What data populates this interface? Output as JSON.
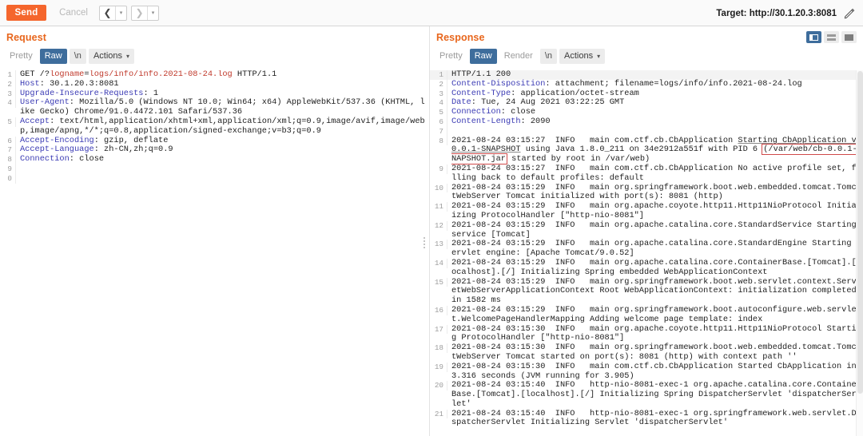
{
  "toolbar": {
    "send_label": "Send",
    "cancel_label": "Cancel",
    "prev_arrow": "❮",
    "next_arrow": "❯",
    "caret": "▾",
    "target_label": "Target: http://30.1.20.3:8081",
    "edit_icon": "pencil-icon"
  },
  "layout": {
    "split_vertical": "split-vertical-layout",
    "split_horizontal": "split-horizontal-layout",
    "single": "single-pane-layout",
    "selected": "split-vertical-layout"
  },
  "request": {
    "title": "Request",
    "tabs": [
      {
        "label": "Pretty",
        "active": false
      },
      {
        "label": "Raw",
        "active": true
      },
      {
        "label": "\\n",
        "active": false
      },
      {
        "label": "Actions",
        "active": false
      }
    ],
    "lines": [
      {
        "n": "1",
        "html": "<span class=\"first-line\">GET /?</span><span class=\"q-key\">logname</span><span class=\"first-line\">=</span><span class=\"q-val\">logs/info/info.2021-08-24.log</span><span class=\"first-line\"> HTTP/1.1</span>"
      },
      {
        "n": "2",
        "html": "<span class=\"hdr-key\">Host</span>: 30.1.20.3:8081"
      },
      {
        "n": "3",
        "html": "<span class=\"hdr-key\">Upgrade-Insecure-Requests</span>: 1"
      },
      {
        "n": "4",
        "html": "<span class=\"hdr-key\">User-Agent</span>: Mozilla/5.0 (Windows NT 10.0; Win64; x64) AppleWebKit/537.36 (KHTML, like Gecko) Chrome/91.0.4472.101 Safari/537.36"
      },
      {
        "n": "5",
        "html": "<span class=\"hdr-key\">Accept</span>: text/html,application/xhtml+xml,application/xml;q=0.9,image/avif,image/webp,image/apng,*/*;q=0.8,application/signed-exchange;v=b3;q=0.9"
      },
      {
        "n": "6",
        "html": "<span class=\"hdr-key\">Accept-Encoding</span>: gzip, deflate"
      },
      {
        "n": "7",
        "html": "<span class=\"hdr-key\">Accept-Language</span>: zh-CN,zh;q=0.9"
      },
      {
        "n": "8",
        "html": "<span class=\"hdr-key\">Connection</span>: close"
      },
      {
        "n": "9",
        "html": ""
      },
      {
        "n": "0",
        "html": ""
      }
    ]
  },
  "response": {
    "title": "Response",
    "tabs": [
      {
        "label": "Pretty",
        "active": false
      },
      {
        "label": "Raw",
        "active": true
      },
      {
        "label": "Render",
        "active": false
      },
      {
        "label": "\\n",
        "active": false
      },
      {
        "label": "Actions",
        "active": false
      }
    ],
    "lines": [
      {
        "n": "1",
        "cls": "res-line1",
        "html": "HTTP/1.1 200"
      },
      {
        "n": "2",
        "html": "<span class=\"hdr-key\">Content-Disposition</span>: attachment; filename=logs/info/info.2021-08-24.log"
      },
      {
        "n": "3",
        "html": "<span class=\"hdr-key\">Content-Type</span>: application/octet-stream"
      },
      {
        "n": "4",
        "html": "<span class=\"hdr-key\">Date</span>: Tue, 24 Aug 2021 03:22:25 GMT"
      },
      {
        "n": "5",
        "html": "<span class=\"hdr-key\">Connection</span>: close"
      },
      {
        "n": "6",
        "html": "<span class=\"hdr-key\">Content-Length</span>: 2090"
      },
      {
        "n": "7",
        "html": ""
      },
      {
        "n": "8",
        "html": "2021-08-24 03:15:27  INFO   main com.ctf.cb.CbApplication <span class=\"underline\">Starting CbApplication v0.0.1-SNAPSHOT</span> using Java 1.8.0_211 on 34e2912a551f with PID 6 <span class=\"redbox\">(/var/web/cb-0.0.1-SNAPSHOT.jar</span> started by root in /var/web)"
      },
      {
        "n": "9",
        "html": "2021-08-24 03:15:27  INFO   main com.ctf.cb.CbApplication No active profile set, falling back to default profiles: default"
      },
      {
        "n": "10",
        "html": "2021-08-24 03:15:29  INFO   main org.springframework.boot.web.embedded.tomcat.TomcatWebServer Tomcat initialized with port(s): 8081 (http)"
      },
      {
        "n": "11",
        "html": "2021-08-24 03:15:29  INFO   main org.apache.coyote.http11.Http11NioProtocol Initializing ProtocolHandler [\"http-nio-8081\"]"
      },
      {
        "n": "12",
        "html": "2021-08-24 03:15:29  INFO   main org.apache.catalina.core.StandardService Starting service [Tomcat]"
      },
      {
        "n": "13",
        "html": "2021-08-24 03:15:29  INFO   main org.apache.catalina.core.StandardEngine Starting Servlet engine: [Apache Tomcat/9.0.52]"
      },
      {
        "n": "14",
        "html": "2021-08-24 03:15:29  INFO   main org.apache.catalina.core.ContainerBase.[Tomcat].[localhost].[/] Initializing Spring embedded WebApplicationContext"
      },
      {
        "n": "15",
        "html": "2021-08-24 03:15:29  INFO   main org.springframework.boot.web.servlet.context.ServletWebServerApplicationContext Root WebApplicationContext: initialization completed in 1582 ms"
      },
      {
        "n": "16",
        "html": "2021-08-24 03:15:29  INFO   main org.springframework.boot.autoconfigure.web.servlet.WelcomePageHandlerMapping Adding welcome page template: index"
      },
      {
        "n": "17",
        "html": "2021-08-24 03:15:30  INFO   main org.apache.coyote.http11.Http11NioProtocol Starting ProtocolHandler [\"http-nio-8081\"]"
      },
      {
        "n": "18",
        "html": "2021-08-24 03:15:30  INFO   main org.springframework.boot.web.embedded.tomcat.TomcatWebServer Tomcat started on port(s): 8081 (http) with context path ''"
      },
      {
        "n": "19",
        "html": "2021-08-24 03:15:30  INFO   main com.ctf.cb.CbApplication Started CbApplication in 3.316 seconds (JVM running for 3.905)"
      },
      {
        "n": "20",
        "html": "2021-08-24 03:15:40  INFO   http-nio-8081-exec-1 org.apache.catalina.core.ContainerBase.[Tomcat].[localhost].[/] Initializing Spring DispatcherServlet 'dispatcherServlet'"
      },
      {
        "n": "21",
        "html": "2021-08-24 03:15:40  INFO   http-nio-8081-exec-1 org.springframework.web.servlet.DispatcherServlet Initializing Servlet 'dispatcherServlet'"
      }
    ]
  },
  "colors": {
    "accent_orange": "#f5662d",
    "panel_title": "#e8661c",
    "tab_active_blue": "#3e6d9c",
    "header_key_blue": "#3a3ab4",
    "query_red": "#c0392b",
    "highlight_box": "#d04a4a"
  }
}
